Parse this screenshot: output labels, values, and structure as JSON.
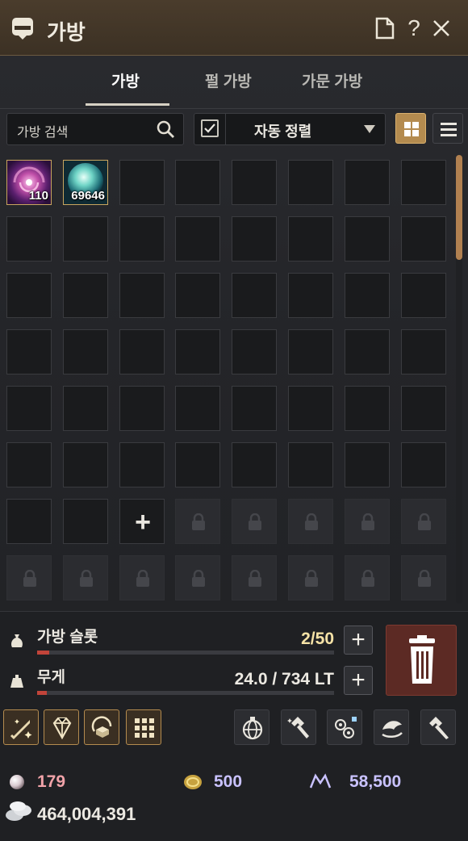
{
  "window": {
    "title": "가방"
  },
  "tabs": [
    {
      "label": "가방",
      "active": true
    },
    {
      "label": "펄 가방",
      "active": false
    },
    {
      "label": "가문 가방",
      "active": false
    }
  ],
  "toolbar": {
    "search_label": "가방 검색",
    "auto_sort_label": "자동 정렬",
    "auto_sort_checked": true
  },
  "inventory": {
    "items": [
      {
        "name": "purple-swirl-item",
        "count": "110"
      },
      {
        "name": "teal-orb-item",
        "count": "69646"
      }
    ],
    "add_slot_symbol": "+"
  },
  "stats": {
    "slots_label": "가방 슬롯",
    "slots_value": "2/50",
    "slots_fraction": 0.04,
    "weight_label": "무게",
    "weight_value": "24.0 / 734 LT",
    "weight_fraction": 0.033
  },
  "currency": {
    "pearl": "179",
    "coin": "500",
    "mileage": "58,500",
    "silver": "464,004,391"
  },
  "colors": {
    "accent_gold": "#b48b4f",
    "bar_fill": "#c1443a",
    "pearl_text": "#f1a3a9",
    "coin_text": "#c9c2ff",
    "slots_value_text": "#f5e2a6"
  }
}
